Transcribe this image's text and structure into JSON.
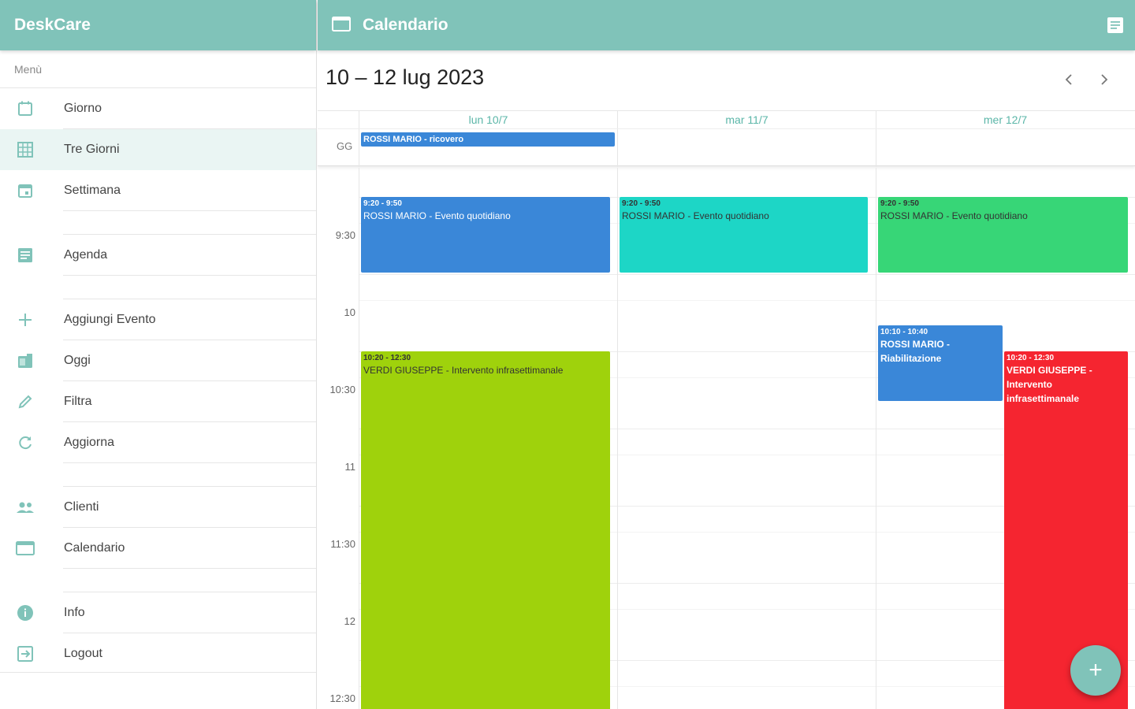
{
  "sidebar": {
    "title": "DeskCare",
    "menu_label": "Menù",
    "items": [
      {
        "label": "Giorno",
        "icon": "calendar-day-icon"
      },
      {
        "label": "Tre Giorni",
        "icon": "grid-icon"
      },
      {
        "label": "Settimana",
        "icon": "calendar-week-icon"
      },
      {
        "label": "Agenda",
        "icon": "agenda-icon"
      },
      {
        "label": "Aggiungi Evento",
        "icon": "plus-icon"
      },
      {
        "label": "Oggi",
        "icon": "today-icon"
      },
      {
        "label": "Filtra",
        "icon": "pencil-icon"
      },
      {
        "label": "Aggiorna",
        "icon": "refresh-icon"
      },
      {
        "label": "Clienti",
        "icon": "people-icon"
      },
      {
        "label": "Calendario",
        "icon": "calendar-icon"
      },
      {
        "label": "Info",
        "icon": "info-icon"
      },
      {
        "label": "Logout",
        "icon": "logout-icon"
      }
    ]
  },
  "topbar": {
    "title": "Calendario"
  },
  "calendar": {
    "range_title": "10 – 12 lug 2023",
    "days": [
      "lun 10/7",
      "mar 11/7",
      "mer 12/7"
    ],
    "allday_label": "GG",
    "allday_event": "ROSSI MARIO - ricovero",
    "time_labels": [
      "9:30",
      "10",
      "10:30",
      "11",
      "11:30",
      "12",
      "12:30"
    ],
    "events": [
      {
        "time": "9:20 - 9:50",
        "title": "ROSSI MARIO - Evento quotidiano"
      },
      {
        "time": "9:20 - 9:50",
        "title": "ROSSI MARIO - Evento quotidiano"
      },
      {
        "time": "9:20 - 9:50",
        "title": "ROSSI MARIO - Evento quotidiano"
      },
      {
        "time": "10:20 - 12:30",
        "title": "VERDI GIUSEPPE - Intervento infrasettimanale"
      },
      {
        "time": "10:10 - 10:40",
        "title": "ROSSI MARIO - Riabilitazione"
      },
      {
        "time": "10:20 - 12:30",
        "title": "VERDI GIUSEPPE - Intervento infrasettimanale"
      }
    ]
  },
  "colors": {
    "header": "#80c3b9",
    "blue": "#3a87d8",
    "teal": "#1dd6c6",
    "green": "#37d677",
    "lime": "#9fd20c",
    "red": "#f52530"
  },
  "fab": {
    "label": "+"
  }
}
